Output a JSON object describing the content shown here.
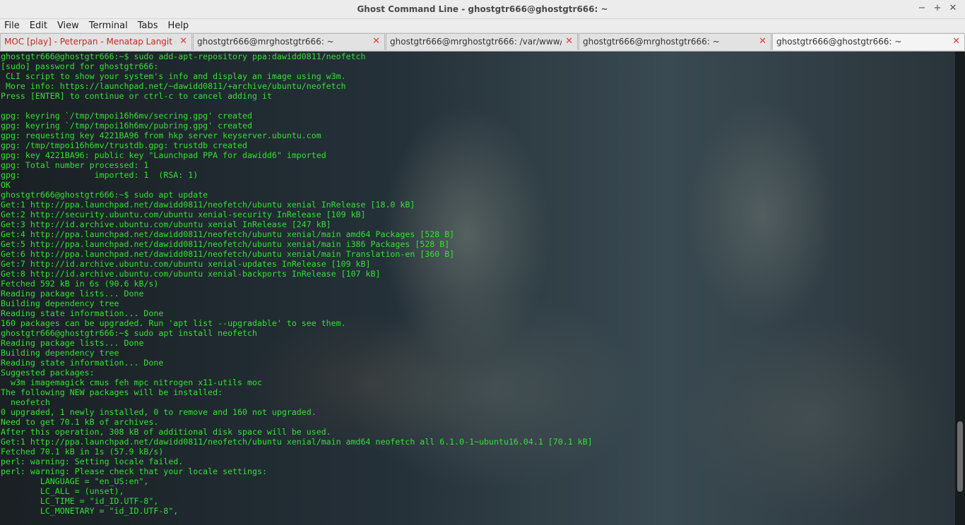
{
  "window": {
    "title": "Ghost Command Line - ghostgtr666@ghostgtr666: ~"
  },
  "menu": [
    "File",
    "Edit",
    "View",
    "Terminal",
    "Tabs",
    "Help"
  ],
  "tabs": [
    {
      "label": "MOC [play] - Peterpan - Menatap Langit ( ...",
      "active": false
    },
    {
      "label": "ghostgtr666@mrghostgtr666: ~",
      "active": false
    },
    {
      "label": "ghostgtr666@mrghostgtr666: /var/www/...",
      "active": false
    },
    {
      "label": "ghostgtr666@mrghostgtr666: ~",
      "active": false
    },
    {
      "label": "ghostgtr666@ghostgtr666: ~",
      "active": true
    }
  ],
  "colors": {
    "terminal_text": "#33e033",
    "tab_close": "#e53935"
  },
  "terminal": {
    "lines": [
      "ghostgtr666@ghostgtr666:~$ sudo add-apt-repository ppa:dawidd0811/neofetch",
      "[sudo] password for ghostgtr666:",
      " CLI script to show your system's info and display an image using w3m.",
      " More info: https://launchpad.net/~dawidd0811/+archive/ubuntu/neofetch",
      "Press [ENTER] to continue or ctrl-c to cancel adding it",
      "",
      "gpg: keyring `/tmp/tmpoi16h6mv/secring.gpg' created",
      "gpg: keyring `/tmp/tmpoi16h6mv/pubring.gpg' created",
      "gpg: requesting key 4221BA96 from hkp server keyserver.ubuntu.com",
      "gpg: /tmp/tmpoi16h6mv/trustdb.gpg: trustdb created",
      "gpg: key 4221BA96: public key \"Launchpad PPA for dawidd6\" imported",
      "gpg: Total number processed: 1",
      "gpg:               imported: 1  (RSA: 1)",
      "OK",
      "ghostgtr666@ghostgtr666:~$ sudo apt update",
      "Get:1 http://ppa.launchpad.net/dawidd0811/neofetch/ubuntu xenial InRelease [18.0 kB]",
      "Get:2 http://security.ubuntu.com/ubuntu xenial-security InRelease [109 kB]",
      "Get:3 http://id.archive.ubuntu.com/ubuntu xenial InRelease [247 kB]",
      "Get:4 http://ppa.launchpad.net/dawidd0811/neofetch/ubuntu xenial/main amd64 Packages [528 B]",
      "Get:5 http://ppa.launchpad.net/dawidd0811/neofetch/ubuntu xenial/main i386 Packages [528 B]",
      "Get:6 http://ppa.launchpad.net/dawidd0811/neofetch/ubuntu xenial/main Translation-en [360 B]",
      "Get:7 http://id.archive.ubuntu.com/ubuntu xenial-updates InRelease [109 kB]",
      "Get:8 http://id.archive.ubuntu.com/ubuntu xenial-backports InRelease [107 kB]",
      "Fetched 592 kB in 6s (90.6 kB/s)",
      "Reading package lists... Done",
      "Building dependency tree",
      "Reading state information... Done",
      "160 packages can be upgraded. Run 'apt list --upgradable' to see them.",
      "ghostgtr666@ghostgtr666:~$ sudo apt install neofetch",
      "Reading package lists... Done",
      "Building dependency tree",
      "Reading state information... Done",
      "Suggested packages:",
      "  w3m imagemagick cmus feh mpc nitrogen x11-utils moc",
      "The following NEW packages will be installed:",
      "  neofetch",
      "0 upgraded, 1 newly installed, 0 to remove and 160 not upgraded.",
      "Need to get 70.1 kB of archives.",
      "After this operation, 308 kB of additional disk space will be used.",
      "Get:1 http://ppa.launchpad.net/dawidd0811/neofetch/ubuntu xenial/main amd64 neofetch all 6.1.0-1~ubuntu16.04.1 [70.1 kB]",
      "Fetched 70.1 kB in 1s (57.9 kB/s)",
      "perl: warning: Setting locale failed.",
      "perl: warning: Please check that your locale settings:",
      "        LANGUAGE = \"en_US:en\",",
      "        LC_ALL = (unset),",
      "        LC_TIME = \"id_ID.UTF-8\",",
      "        LC_MONETARY = \"id_ID.UTF-8\","
    ]
  }
}
